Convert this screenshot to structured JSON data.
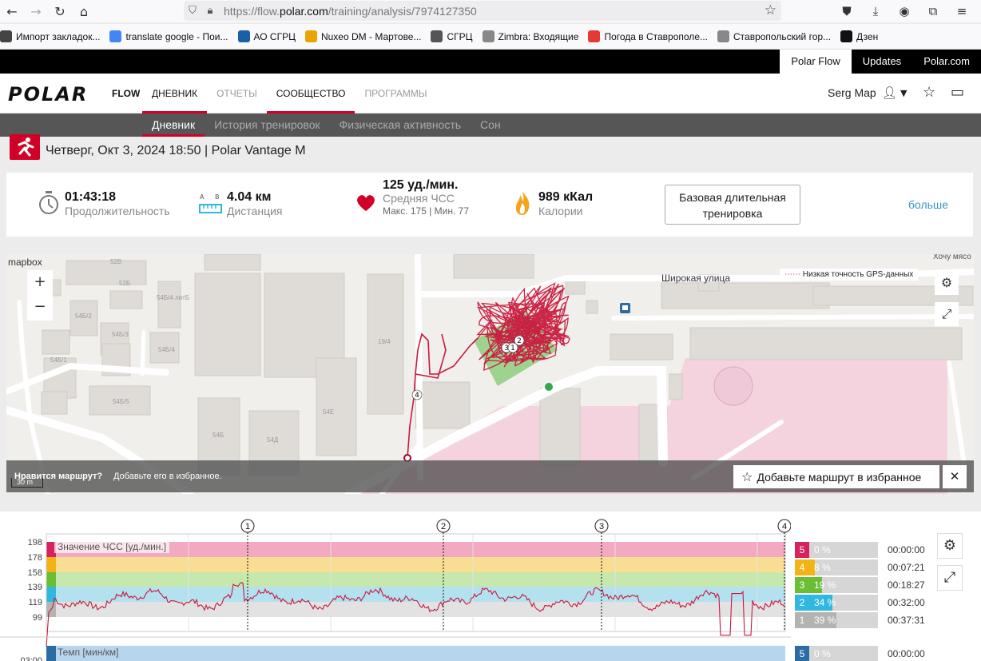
{
  "browser": {
    "url_prefix": "https://flow.",
    "url_domain": "polar.com",
    "url_path": "/training/analysis/7974127350"
  },
  "bookmarks": [
    {
      "label": "Импорт закладок...",
      "icon": "import-icon",
      "color": "#444444"
    },
    {
      "label": "translate google - Пои...",
      "icon": "google-icon",
      "color": "#4285f4"
    },
    {
      "label": "АО СГРЦ",
      "icon": "sgrc-icon",
      "color": "#1b5fa8"
    },
    {
      "label": "Nuxeo DM - Мартове...",
      "icon": "nuxeo-icon",
      "color": "#e8a400"
    },
    {
      "label": "СГРЦ",
      "icon": "globe-icon",
      "color": "#555555"
    },
    {
      "label": "Zimbra: Входящие",
      "icon": "zimbra-icon",
      "color": "#888888"
    },
    {
      "label": "Погода в Ставрополе...",
      "icon": "yandex-icon",
      "color": "#e53935"
    },
    {
      "label": "Ставропольский гор...",
      "icon": "sgrc-small-icon",
      "color": "#888888"
    },
    {
      "label": "Дзен",
      "icon": "dzen-icon",
      "color": "#111111"
    }
  ],
  "top_links": [
    "Polar Flow",
    "Updates",
    "Polar.com"
  ],
  "header": {
    "logo": "POLAR",
    "flow": "FLOW",
    "nav": [
      "ДНЕВНИК",
      "ОТЧЕТЫ",
      "СООБЩЕСТВО",
      "ПРОГРАММЫ"
    ],
    "user": "Serg Map"
  },
  "subnav": [
    "Дневник",
    "История тренировок",
    "Физическая активность",
    "Сон"
  ],
  "training": {
    "title": "Четверг, Окт 3, 2024 18:50 | Polar Vantage M",
    "duration": "01:43:18",
    "duration_label": "Продолжительность",
    "distance": "4.04 км",
    "distance_label": "Дистанция",
    "hr_avg": "125 уд./мин.",
    "hr_label": "Средняя ЧСС",
    "hr_minmax": "Макс. 175  |  Мин. 77",
    "calories": "989 кКал",
    "calories_label": "Калории",
    "benefit": "Базовая длительная тренировка",
    "more": "больше"
  },
  "map": {
    "mapbox": "mapbox",
    "street": "Широкая улица",
    "corner": "Хочу мясо",
    "gps_legend": "Низкая точность GPS-данных",
    "like_q": "Нравится маршрут?",
    "like_t": "Добавьте его в избранное.",
    "fav_btn": "Добавьте маршрут в избранное",
    "scale": "30 m",
    "buildings": [
      "52В",
      "52Б",
      "54Б/2",
      "54Б/4 литБ",
      "54Б/3",
      "54Б/1",
      "54Б/4",
      "54Б/5",
      "19/4",
      "54Е",
      "54Б",
      "54Д"
    ]
  },
  "chart": {
    "hr_label": "Значение ЧСС [уд./мин.]",
    "pace_label": "Темп [мин/км]",
    "pace_tick": "03:00",
    "y_ticks": [
      "198",
      "178",
      "158",
      "139",
      "119",
      "99"
    ],
    "laps": [
      "1",
      "2",
      "3",
      "4"
    ],
    "zones": [
      {
        "zone": "5",
        "pct": "0 %",
        "fraction": 0,
        "time": "00:00:00",
        "color": "#d6225e"
      },
      {
        "zone": "4",
        "pct": "8 %",
        "fraction": 0.08,
        "time": "00:07:21",
        "color": "#f2b414"
      },
      {
        "zone": "3",
        "pct": "19 %",
        "fraction": 0.19,
        "time": "00:18:27",
        "color": "#6abe34"
      },
      {
        "zone": "2",
        "pct": "34 %",
        "fraction": 0.34,
        "time": "00:32:00",
        "color": "#31b8e0"
      },
      {
        "zone": "1",
        "pct": "39 %",
        "fraction": 0.39,
        "time": "00:37:31",
        "color": "#b3b3b3"
      }
    ],
    "pace_zone": {
      "zone": "5",
      "pct": "0 %",
      "time": "00:00:00"
    }
  }
}
